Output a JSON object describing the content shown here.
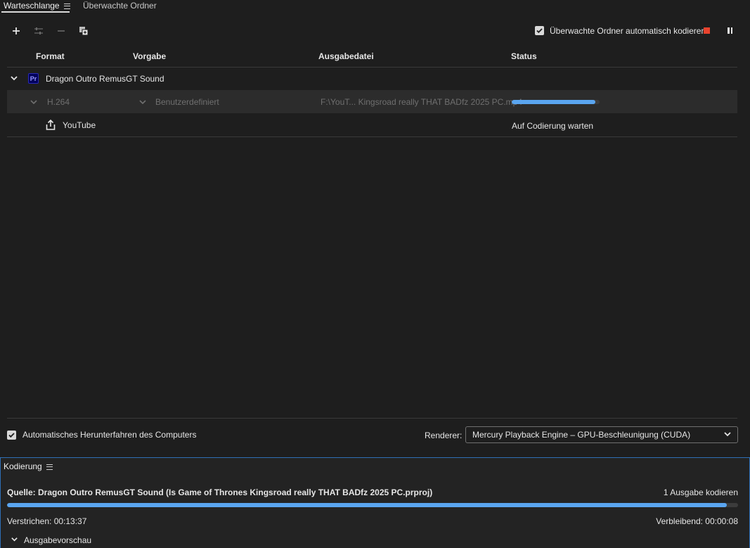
{
  "tabs": {
    "queue": "Warteschlange",
    "watched": "Überwachte Ordner"
  },
  "toolbar": {
    "add_icon": "plus-icon",
    "settings_icon": "sliders-icon",
    "remove_icon": "minus-icon",
    "duplicate_icon": "duplicate-icon",
    "auto_encode_label": "Überwachte Ordner automatisch kodieren",
    "stop_color": "#e8432e"
  },
  "table": {
    "headers": {
      "format": "Format",
      "preset": "Vorgabe",
      "output": "Ausgabedatei",
      "status": "Status"
    },
    "source": {
      "badge": "Pr",
      "name": "Dragon Outro RemusGT Sound"
    },
    "item": {
      "format": "H.264",
      "preset": "Benutzerdefiniert",
      "output": "F:\\YouT... Kingsroad really THAT BADfz 2025 PC.mp4",
      "progress": 0.95
    },
    "publish": {
      "name": "YouTube",
      "status": "Auf Codierung warten"
    }
  },
  "footer": {
    "shutdown_label": "Automatisches Herunterfahren des Computers",
    "renderer_label": "Renderer:",
    "renderer_value": "Mercury Playback Engine – GPU-Beschleunigung (CUDA)"
  },
  "encoding": {
    "title": "Kodierung",
    "source_line": "Quelle: Dragon Outro RemusGT Sound (Is Game of Thrones Kingsroad really THAT BADfz 2025 PC.prproj)",
    "output_count": "1 Ausgabe kodieren",
    "progress": 0.985,
    "elapsed": "Verstrichen: 00:13:37",
    "remaining": "Verbleibend: 00:00:08",
    "preview_label": "Ausgabevorschau"
  },
  "colors": {
    "accent": "#5aa5f0",
    "panel_border": "#2f6fb5"
  }
}
